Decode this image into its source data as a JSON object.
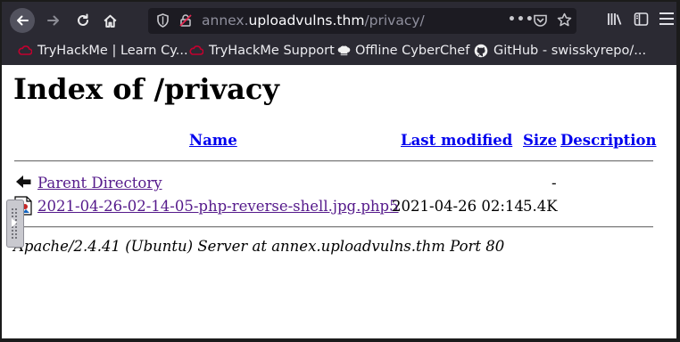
{
  "browser": {
    "url": {
      "domain_prefix": "annex.",
      "domain_main": "uploadvulns.thm",
      "path": "/privacy/"
    },
    "page_actions_icon": "ellipsis-icon",
    "bookmarks": [
      {
        "label": "TryHackMe | Learn Cy...",
        "icon": "tryhackme-icon"
      },
      {
        "label": "TryHackMe Support",
        "icon": "tryhackme-icon"
      },
      {
        "label": "Offline CyberChef",
        "icon": "chef-hat-icon"
      },
      {
        "label": "GitHub - swisskyrepo/...",
        "icon": "github-icon"
      }
    ]
  },
  "page": {
    "title": "Index of /privacy",
    "columns": {
      "name": "Name",
      "last_modified": "Last modified",
      "size": "Size",
      "description": "Description"
    },
    "rows": [
      {
        "name": "Parent Directory",
        "last_modified": "",
        "size": "-",
        "description": "",
        "icon": "back-arrow-icon"
      },
      {
        "name": "2021-04-26-02-14-05-php-reverse-shell.jpg.php5",
        "last_modified": "2021-04-26 02:14",
        "size": "5.4K",
        "description": "",
        "icon": "image-file-icon"
      }
    ],
    "address": "Apache/2.4.41 (Ubuntu) Server at annex.uploadvulns.thm Port 80"
  },
  "colors": {
    "chrome": "#2b2a33",
    "urlbar": "#1c1b22",
    "link": "#0000ee",
    "visited_link": "#551a8b"
  }
}
